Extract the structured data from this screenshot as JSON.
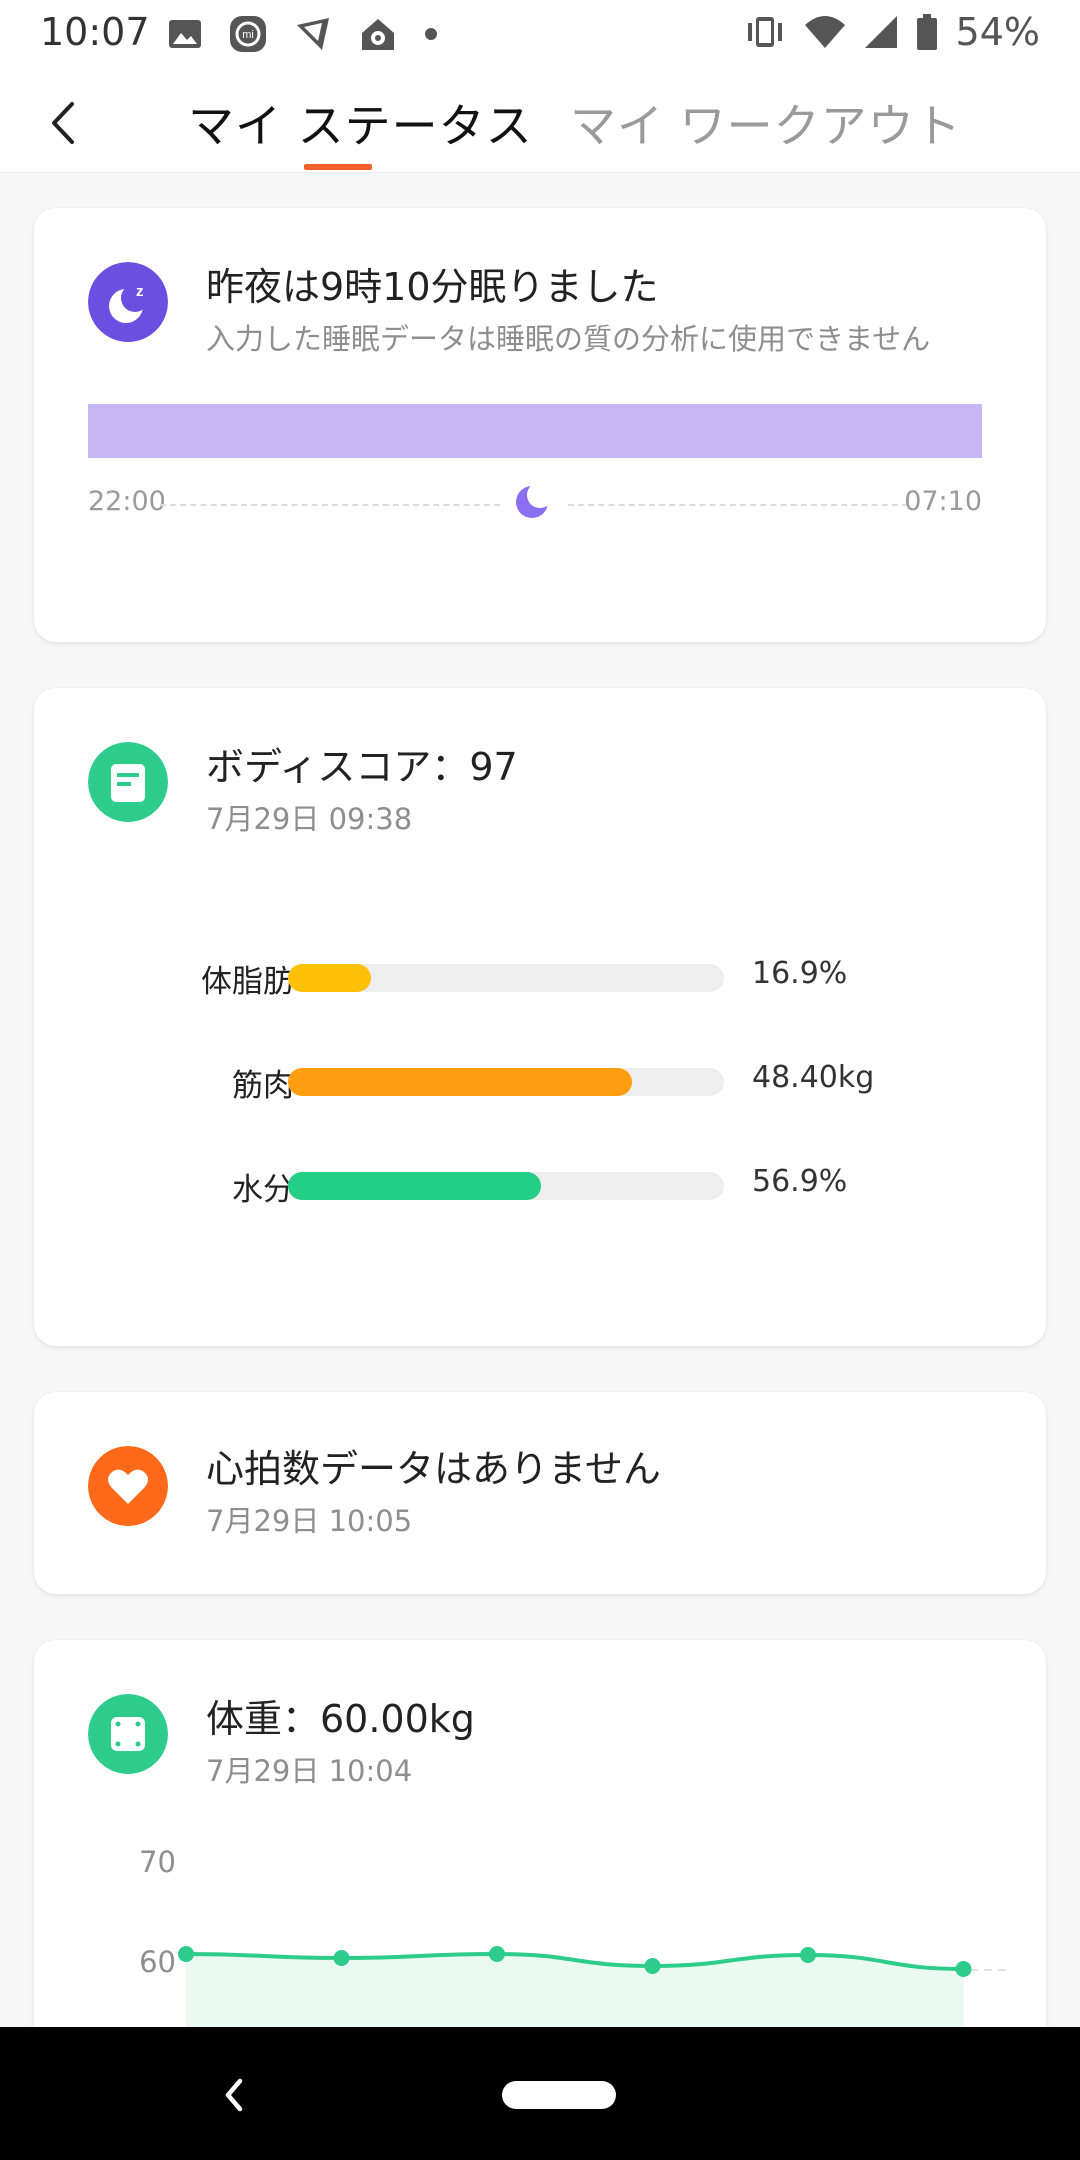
{
  "status_bar": {
    "time": "10:07",
    "battery": "54%",
    "icons": [
      "image-icon",
      "mi-icon",
      "kite-icon",
      "home-icon",
      "dot-icon"
    ],
    "right_icons": [
      "vibrate-icon",
      "wifi-icon",
      "signal-icon",
      "battery-icon"
    ]
  },
  "header": {
    "tabs": [
      {
        "label": "マイ ステータス",
        "active": true
      },
      {
        "label": "マイ ワークアウト",
        "active": false
      }
    ],
    "accent": "#f2612a"
  },
  "sleep": {
    "title": "昨夜は9時10分眠りました",
    "subtitle": "入力した睡眠データは睡眠の質の分析に使用できません",
    "start_time": "22:00",
    "end_time": "07:10",
    "color": "#6a4fe0",
    "bar_color": "#c7b8f5"
  },
  "body_score": {
    "title": "ボディスコア：97",
    "date": "7月29日 09:38",
    "color": "#2ecc8a",
    "metrics": [
      {
        "label": "体脂肪",
        "value": "16.9%",
        "fill": 0.19,
        "color": "#ffc107"
      },
      {
        "label": "筋肉",
        "value": "48.40kg",
        "fill": 0.79,
        "color": "#ff9f0f"
      },
      {
        "label": "水分",
        "value": "56.9%",
        "fill": 0.58,
        "color": "#23cf86"
      }
    ]
  },
  "heart_rate": {
    "title": "心拍数データはありません",
    "date": "7月29日 10:05",
    "color": "#ff6a1a"
  },
  "weight": {
    "title": "体重：60.00kg",
    "date": "7月29日 10:04",
    "color": "#2ecc8a",
    "y_labels": [
      "70",
      "60"
    ],
    "points": [
      60.8,
      60.4,
      60.8,
      59.6,
      60.7,
      59.3
    ]
  },
  "nav": {
    "icons": [
      "nav-back-icon",
      "nav-home-pill"
    ]
  }
}
